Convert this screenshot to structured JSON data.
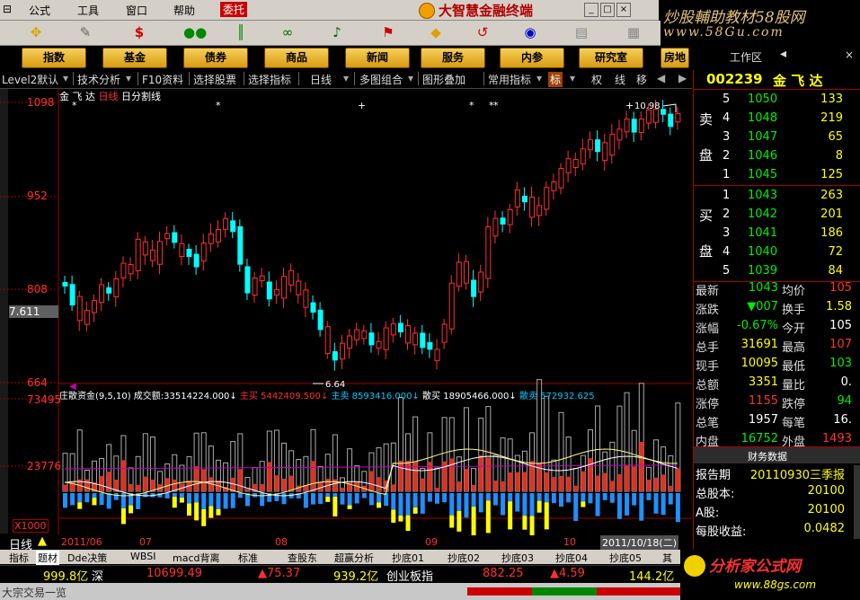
{
  "menu": {
    "items": [
      "公式",
      "工具",
      "窗口",
      "帮助",
      "委托"
    ],
    "app_title": "大智慧金融终端"
  },
  "watermark": {
    "line1": "炒股輔助教材58股网",
    "line2": "www.58Gu.com"
  },
  "nav": [
    "指数",
    "基金",
    "债券",
    "商品",
    "新闻",
    "服务",
    "内参",
    "研究室",
    "房地产"
  ],
  "nav_right": "工作区",
  "subbar": {
    "items": [
      "Level2默认",
      "技术分析",
      "F10资料",
      "选择股票",
      "选择指标",
      "日线",
      "多图组合",
      "图形叠加",
      "常用指标",
      "标",
      "权",
      "线",
      "移"
    ]
  },
  "chart_header": {
    "stock": "金 飞 达",
    "period": "日线",
    "split": "日分割线"
  },
  "price_axis": [
    "1098",
    "952",
    "808",
    "664"
  ],
  "price_marker": "7.611",
  "price_high_label": "10.98",
  "price_low_label": "6.64",
  "indicator_header": {
    "name": "庄散资金(9,5,10)",
    "volume_label": "成交额:",
    "volume_value": "33514224.000↓",
    "main_buy_label": "主买",
    "main_buy_value": "5442409.500↓",
    "main_sell_label": "主卖",
    "main_sell_value": "8593416.000↓",
    "retail_buy_label": "散买",
    "retail_buy_value": "18905466.000↓",
    "retail_sell_label": "散卖",
    "retail_sell_value": "572932.625"
  },
  "vol_axis": [
    "73495",
    "23776"
  ],
  "vol_multiplier": "X1000",
  "time_axis": {
    "period_tag": "日线",
    "labels": [
      "2011/06",
      "07",
      "08",
      "09",
      "10"
    ],
    "current_date": "2011/10/18(二)"
  },
  "stock_panel": {
    "code": "002239",
    "name": "金 飞 达",
    "sell_label": "卖",
    "sell_label2": "盘",
    "buy_label": "买",
    "buy_label2": "盘",
    "asks": [
      {
        "level": "5",
        "price": "1050",
        "vol": "133"
      },
      {
        "level": "4",
        "price": "1048",
        "vol": "219"
      },
      {
        "level": "3",
        "price": "1047",
        "vol": "65"
      },
      {
        "level": "2",
        "price": "1046",
        "vol": "8"
      },
      {
        "level": "1",
        "price": "1045",
        "vol": "125"
      }
    ],
    "bids": [
      {
        "level": "1",
        "price": "1043",
        "vol": "263"
      },
      {
        "level": "2",
        "price": "1042",
        "vol": "201"
      },
      {
        "level": "3",
        "price": "1041",
        "vol": "186"
      },
      {
        "level": "4",
        "price": "1040",
        "vol": "72"
      },
      {
        "level": "5",
        "price": "1039",
        "vol": "84"
      }
    ],
    "stats": [
      {
        "l1": "最新",
        "v1": "1043",
        "c1": "green",
        "l2": "均价",
        "v2": "105",
        "c2": "red"
      },
      {
        "l1": "涨跌",
        "v1": "▼007",
        "c1": "green",
        "l2": "换手",
        "v2": "1.58",
        "c2": "yellow"
      },
      {
        "l1": "涨幅",
        "v1": "-0.67%",
        "c1": "green",
        "l2": "今开",
        "v2": "105",
        "c2": "white"
      },
      {
        "l1": "总手",
        "v1": "31691",
        "c1": "yellow",
        "l2": "最高",
        "v2": "107",
        "c2": "red"
      },
      {
        "l1": "现手",
        "v1": "10095",
        "c1": "yellow",
        "l2": "最低",
        "v2": "103",
        "c2": "green"
      },
      {
        "l1": "总额",
        "v1": "3351",
        "c1": "yellow",
        "l2": "量比",
        "v2": "0.",
        "c2": "white"
      },
      {
        "l1": "涨停",
        "v1": "1155",
        "c1": "red",
        "l2": "跌停",
        "v2": "94",
        "c2": "green"
      },
      {
        "l1": "总笔",
        "v1": "1957",
        "c1": "white",
        "l2": "每笔",
        "v2": "16.",
        "c2": "white"
      },
      {
        "l1": "内盘",
        "v1": "16752",
        "c1": "green",
        "l2": "外盘",
        "v2": "1493",
        "c2": "red"
      }
    ],
    "finance_title": "财务数据",
    "finance": [
      {
        "label": "报告期",
        "value": "20110930三季报"
      },
      {
        "label": "总股本:",
        "value": "20100"
      },
      {
        "label": "A股:",
        "value": "20100"
      },
      {
        "label": "每股收益:",
        "value": "0.0482"
      }
    ]
  },
  "tabs": [
    "指标",
    "题材",
    "Dde决策",
    "WBSI",
    "macd背离",
    "标准",
    "查股东",
    "超赢分析",
    "抄底01",
    "抄底02",
    "抄底03",
    "抄底04",
    "抄底05",
    "其"
  ],
  "status": [
    {
      "value": "999.8亿",
      "color": "#ffff00"
    },
    {
      "value": "深",
      "color": "#fff"
    },
    {
      "value": "10699.49",
      "color": "#ff3030"
    },
    {
      "value": "▲75.37",
      "color": "#ff3030"
    },
    {
      "value": "939.2亿",
      "color": "#ffff00"
    },
    {
      "value": "创业板指",
      "color": "#fff"
    },
    {
      "value": "882.25",
      "color": "#ff3030"
    },
    {
      "value": "▲4.59",
      "color": "#ff3030"
    },
    {
      "value": "144.2亿",
      "color": "#ffff00"
    }
  ],
  "footer": "大宗交易一览",
  "watermark_bottom": {
    "line1": "分析家公式网",
    "line2": "www.88gs.com"
  },
  "colors": {
    "up": "#ff3030",
    "down": "#00ffff",
    "bg": "#000000",
    "grid": "#a00000"
  }
}
